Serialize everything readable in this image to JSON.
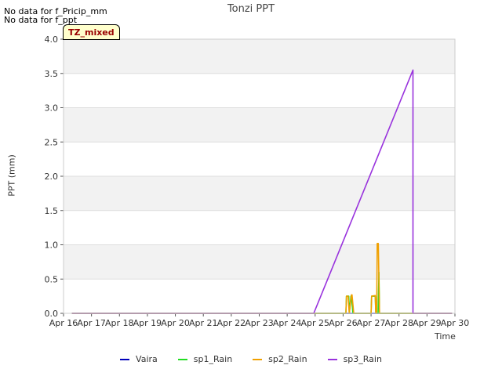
{
  "notes": [
    "No data for f_Pricip_mm",
    "No data for f_ppt"
  ],
  "chart_data": {
    "type": "line",
    "title": "Tonzi PPT",
    "xlabel": "Time",
    "ylabel": "PPT (mm)",
    "annotation": "TZ_mixed",
    "xlim": [
      16,
      30
    ],
    "ylim": [
      0,
      4.0
    ],
    "x_tick_values": [
      16,
      17,
      18,
      19,
      20,
      21,
      22,
      23,
      24,
      25,
      26,
      27,
      28,
      29,
      30
    ],
    "x_ticks": [
      "Apr 16",
      "Apr 17",
      "Apr 18",
      "Apr 19",
      "Apr 20",
      "Apr 21",
      "Apr 22",
      "Apr 23",
      "Apr 24",
      "Apr 25",
      "Apr 26",
      "Apr 27",
      "Apr 28",
      "Apr 29",
      "Apr 30"
    ],
    "y_ticks": [
      "0.0",
      "0.5",
      "1.0",
      "1.5",
      "2.0",
      "2.5",
      "3.0",
      "3.5",
      "4.0"
    ],
    "y_tick_values": [
      0,
      0.5,
      1.0,
      1.5,
      2.0,
      2.5,
      3.0,
      3.5,
      4.0
    ],
    "grid": true,
    "legend_position": "bottom",
    "series": [
      {
        "name": "Vaira",
        "color": "#0000bb",
        "x": [
          16.3,
          29.9
        ],
        "y": [
          0,
          0
        ]
      },
      {
        "name": "sp1_Rain",
        "color": "#22dd22",
        "x": [
          16.3,
          25.0,
          26.1,
          26.12,
          26.2,
          26.22,
          26.28,
          26.3,
          26.35,
          27.0,
          27.02,
          27.15,
          27.17,
          27.25,
          27.28,
          27.3,
          29.9
        ],
        "y": [
          0,
          0,
          0,
          0.25,
          0.25,
          0,
          0.25,
          0.25,
          0,
          0,
          0.25,
          0.25,
          0,
          0,
          0.6,
          0,
          0
        ]
      },
      {
        "name": "sp2_Rain",
        "color": "#f0a000",
        "x": [
          16.3,
          25.0,
          26.1,
          26.12,
          26.18,
          26.22,
          26.3,
          26.32,
          26.38,
          27.0,
          27.02,
          27.15,
          27.17,
          27.2,
          27.22,
          27.26,
          27.3,
          29.9
        ],
        "y": [
          0,
          0,
          0,
          0.25,
          0.25,
          0,
          0.27,
          0.27,
          0,
          0,
          0.25,
          0.26,
          0,
          0,
          1.02,
          1.02,
          0,
          0
        ]
      },
      {
        "name": "sp3_Rain",
        "color": "#9933dd",
        "x": [
          16.3,
          24.95,
          28.5,
          28.5,
          29.9
        ],
        "y": [
          0,
          0,
          3.55,
          0,
          0
        ]
      }
    ]
  }
}
